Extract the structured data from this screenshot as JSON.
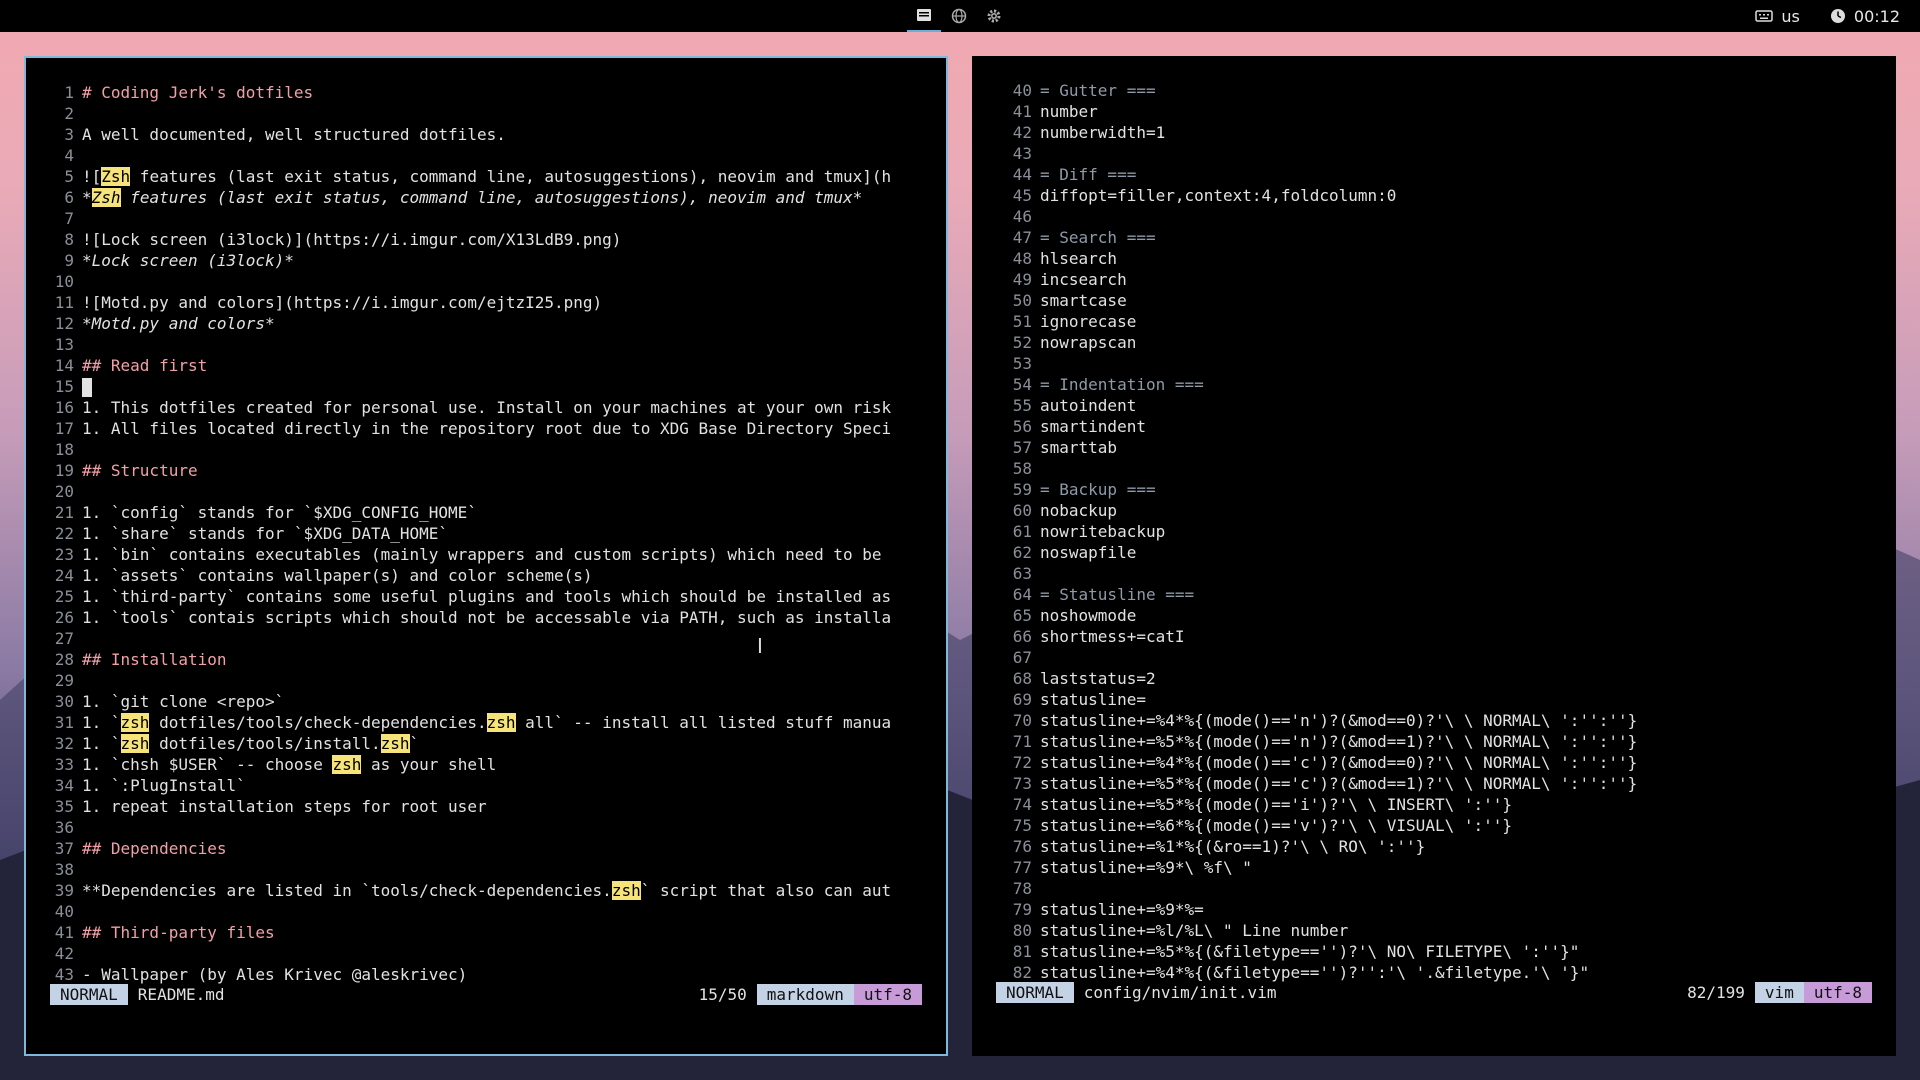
{
  "topbar": {
    "workspaces": [
      {
        "icon": "terminal-icon",
        "active": true
      },
      {
        "icon": "globe-icon",
        "active": false
      },
      {
        "icon": "gear-icon",
        "active": false
      }
    ],
    "keyboard_layout": "us",
    "clock": "00:12"
  },
  "left_pane": {
    "lines": [
      {
        "n": "1",
        "t": "# Coding Jerk's dotfiles"
      },
      {
        "n": "2",
        "t": ""
      },
      {
        "n": "3",
        "t": "A well documented, well structured dotfiles."
      },
      {
        "n": "4",
        "t": ""
      },
      {
        "n": "5",
        "t": "![Zsh features (last exit status, command line, autosuggestions), neovim and tmux](h"
      },
      {
        "n": "6",
        "t": "*Zsh features (last exit status, command line, autosuggestions), neovim and tmux*"
      },
      {
        "n": "7",
        "t": ""
      },
      {
        "n": "8",
        "t": "![Lock screen (i3lock)](https://i.imgur.com/X13LdB9.png)"
      },
      {
        "n": "9",
        "t": "*Lock screen (i3lock)*"
      },
      {
        "n": "10",
        "t": ""
      },
      {
        "n": "11",
        "t": "![Motd.py and colors](https://i.imgur.com/ejtzI25.png)"
      },
      {
        "n": "12",
        "t": "*Motd.py and colors*"
      },
      {
        "n": "13",
        "t": ""
      },
      {
        "n": "14",
        "t": "## Read first"
      },
      {
        "n": "15",
        "t": ""
      },
      {
        "n": "16",
        "t": "1. This dotfiles created for personal use. Install on your machines at your own risk"
      },
      {
        "n": "17",
        "t": "1. All files located directly in the repository root due to XDG Base Directory Speci"
      },
      {
        "n": "18",
        "t": ""
      },
      {
        "n": "19",
        "t": "## Structure"
      },
      {
        "n": "20",
        "t": ""
      },
      {
        "n": "21",
        "t": "1. `config` stands for `$XDG_CONFIG_HOME`"
      },
      {
        "n": "22",
        "t": "1. `share` stands for `$XDG_DATA_HOME`"
      },
      {
        "n": "23",
        "t": "1. `bin` contains executables (mainly wrappers and custom scripts) which need to be"
      },
      {
        "n": "24",
        "t": "1. `assets` contains wallpaper(s) and color scheme(s)"
      },
      {
        "n": "25",
        "t": "1. `third-party` contains some useful plugins and tools which should be installed as"
      },
      {
        "n": "26",
        "t": "1. `tools` contais scripts which should not be accessable via PATH, such as installa"
      },
      {
        "n": "27",
        "t": ""
      },
      {
        "n": "28",
        "t": "## Installation"
      },
      {
        "n": "29",
        "t": ""
      },
      {
        "n": "30",
        "t": "1. `git clone <repo>`"
      },
      {
        "n": "31",
        "t": "1. `zsh dotfiles/tools/check-dependencies.zsh all` -- install all listed stuff manua"
      },
      {
        "n": "32",
        "t": "1. `zsh dotfiles/tools/install.zsh`"
      },
      {
        "n": "33",
        "t": "1. `chsh $USER` -- choose zsh as your shell"
      },
      {
        "n": "34",
        "t": "1. `:PlugInstall`"
      },
      {
        "n": "35",
        "t": "1. repeat installation steps for root user"
      },
      {
        "n": "36",
        "t": ""
      },
      {
        "n": "37",
        "t": "## Dependencies"
      },
      {
        "n": "38",
        "t": ""
      },
      {
        "n": "39",
        "t": "**Dependencies are listed in `tools/check-dependencies.zsh` script that also can aut"
      },
      {
        "n": "40",
        "t": ""
      },
      {
        "n": "41",
        "t": "## Third-party files"
      },
      {
        "n": "42",
        "t": ""
      },
      {
        "n": "43",
        "t": "- Wallpaper (by Ales Krivec @aleskrivec)"
      }
    ],
    "status": {
      "mode": "NORMAL",
      "file": "README.md",
      "position": "15/50",
      "filetype": "markdown",
      "encoding": "utf-8"
    }
  },
  "right_pane": {
    "lines": [
      {
        "n": "40",
        "t": "= Gutter ==="
      },
      {
        "n": "41",
        "t": "number"
      },
      {
        "n": "42",
        "t": "numberwidth=1"
      },
      {
        "n": "43",
        "t": ""
      },
      {
        "n": "44",
        "t": "= Diff ==="
      },
      {
        "n": "45",
        "t": "diffopt=filler,context:4,foldcolumn:0"
      },
      {
        "n": "46",
        "t": ""
      },
      {
        "n": "47",
        "t": "= Search ==="
      },
      {
        "n": "48",
        "t": "hlsearch"
      },
      {
        "n": "49",
        "t": "incsearch"
      },
      {
        "n": "50",
        "t": "smartcase"
      },
      {
        "n": "51",
        "t": "ignorecase"
      },
      {
        "n": "52",
        "t": "nowrapscan"
      },
      {
        "n": "53",
        "t": ""
      },
      {
        "n": "54",
        "t": "= Indentation ==="
      },
      {
        "n": "55",
        "t": "autoindent"
      },
      {
        "n": "56",
        "t": "smartindent"
      },
      {
        "n": "57",
        "t": "smarttab"
      },
      {
        "n": "58",
        "t": ""
      },
      {
        "n": "59",
        "t": "= Backup ==="
      },
      {
        "n": "60",
        "t": "nobackup"
      },
      {
        "n": "61",
        "t": "nowritebackup"
      },
      {
        "n": "62",
        "t": "noswapfile"
      },
      {
        "n": "63",
        "t": ""
      },
      {
        "n": "64",
        "t": "= Statusline ==="
      },
      {
        "n": "65",
        "t": "noshowmode"
      },
      {
        "n": "66",
        "t": "shortmess+=catI"
      },
      {
        "n": "67",
        "t": ""
      },
      {
        "n": "68",
        "t": "laststatus=2"
      },
      {
        "n": "69",
        "t": "statusline="
      },
      {
        "n": "70",
        "t": "statusline+=%4*%{(mode()=='n')?(&mod==0)?'\\ \\ NORMAL\\ ':'':''}"
      },
      {
        "n": "71",
        "t": "statusline+=%5*%{(mode()=='n')?(&mod==1)?'\\ \\ NORMAL\\ ':'':''}"
      },
      {
        "n": "72",
        "t": "statusline+=%4*%{(mode()=='c')?(&mod==0)?'\\ \\ NORMAL\\ ':'':''}"
      },
      {
        "n": "73",
        "t": "statusline+=%5*%{(mode()=='c')?(&mod==1)?'\\ \\ NORMAL\\ ':'':''}"
      },
      {
        "n": "74",
        "t": "statusline+=%5*%{(mode()=='i')?'\\ \\ INSERT\\ ':''}"
      },
      {
        "n": "75",
        "t": "statusline+=%6*%{(mode()=='v')?'\\ \\ VISUAL\\ ':''}"
      },
      {
        "n": "76",
        "t": "statusline+=%1*%{(&ro==1)?'\\ \\ RO\\ ':''}"
      },
      {
        "n": "77",
        "t": "statusline+=%9*\\ %f\\ \""
      },
      {
        "n": "78",
        "t": ""
      },
      {
        "n": "79",
        "t": "statusline+=%9*%="
      },
      {
        "n": "80",
        "t": "statusline+=%l/%L\\ \" Line number"
      },
      {
        "n": "81",
        "t": "statusline+=%5*%{(&filetype=='')?'\\ NO\\ FILETYPE\\ ':''}\""
      },
      {
        "n": "82",
        "t": "statusline+=%4*%{(&filetype=='')?'':'\\ '.&filetype.'\\ '}\""
      }
    ],
    "status": {
      "mode": "NORMAL",
      "file": "config/nvim/init.vim",
      "position": "82/199",
      "filetype": "vim",
      "encoding": "utf-8"
    }
  },
  "colors": {
    "heading": "#f2a0a8",
    "comment": "#8e9aa8",
    "search_highlight": "#f6e37a",
    "mode_bg": "#c3d2e4",
    "encoding_bg": "#c79ad8",
    "active_border": "#7fb8d8"
  },
  "search_term": "zsh"
}
